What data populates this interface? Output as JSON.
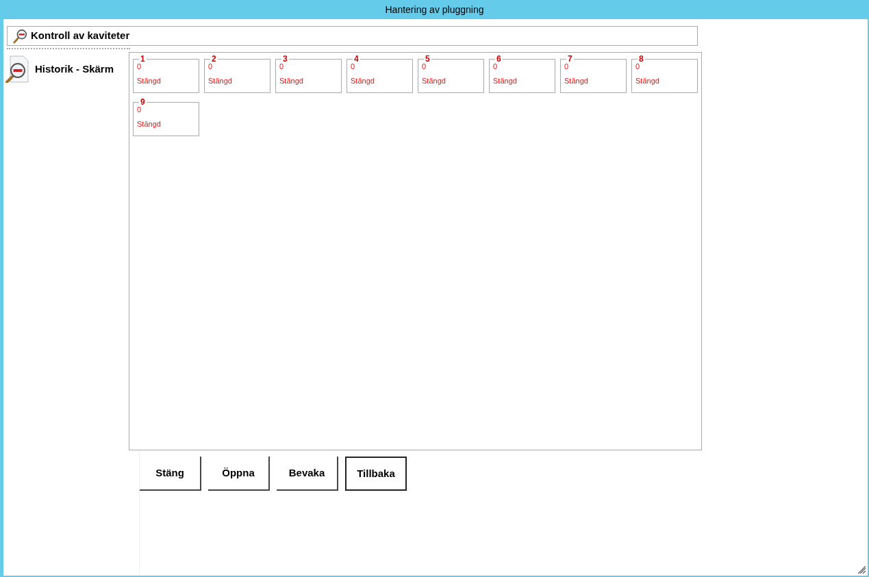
{
  "window": {
    "title": "Hantering av pluggning"
  },
  "header": {
    "title": "Kontroll av kaviteter"
  },
  "nav": {
    "label": "Historik - Skärm"
  },
  "cavities": [
    {
      "number": "1",
      "value": "0",
      "status": "Stängd"
    },
    {
      "number": "2",
      "value": "0",
      "status": "Stängd"
    },
    {
      "number": "3",
      "value": "0",
      "status": "Stängd"
    },
    {
      "number": "4",
      "value": "0",
      "status": "Stängd"
    },
    {
      "number": "5",
      "value": "0",
      "status": "Stängd"
    },
    {
      "number": "6",
      "value": "0",
      "status": "Stängd"
    },
    {
      "number": "7",
      "value": "0",
      "status": "Stängd"
    },
    {
      "number": "8",
      "value": "0",
      "status": "Stängd"
    },
    {
      "number": "9",
      "value": "0",
      "status": "Stängd"
    }
  ],
  "buttons": [
    {
      "label": "Stäng",
      "focused": false
    },
    {
      "label": "Öppna",
      "focused": false
    },
    {
      "label": "Bevaka",
      "focused": false
    },
    {
      "label": "Tillbaka",
      "focused": true
    }
  ]
}
